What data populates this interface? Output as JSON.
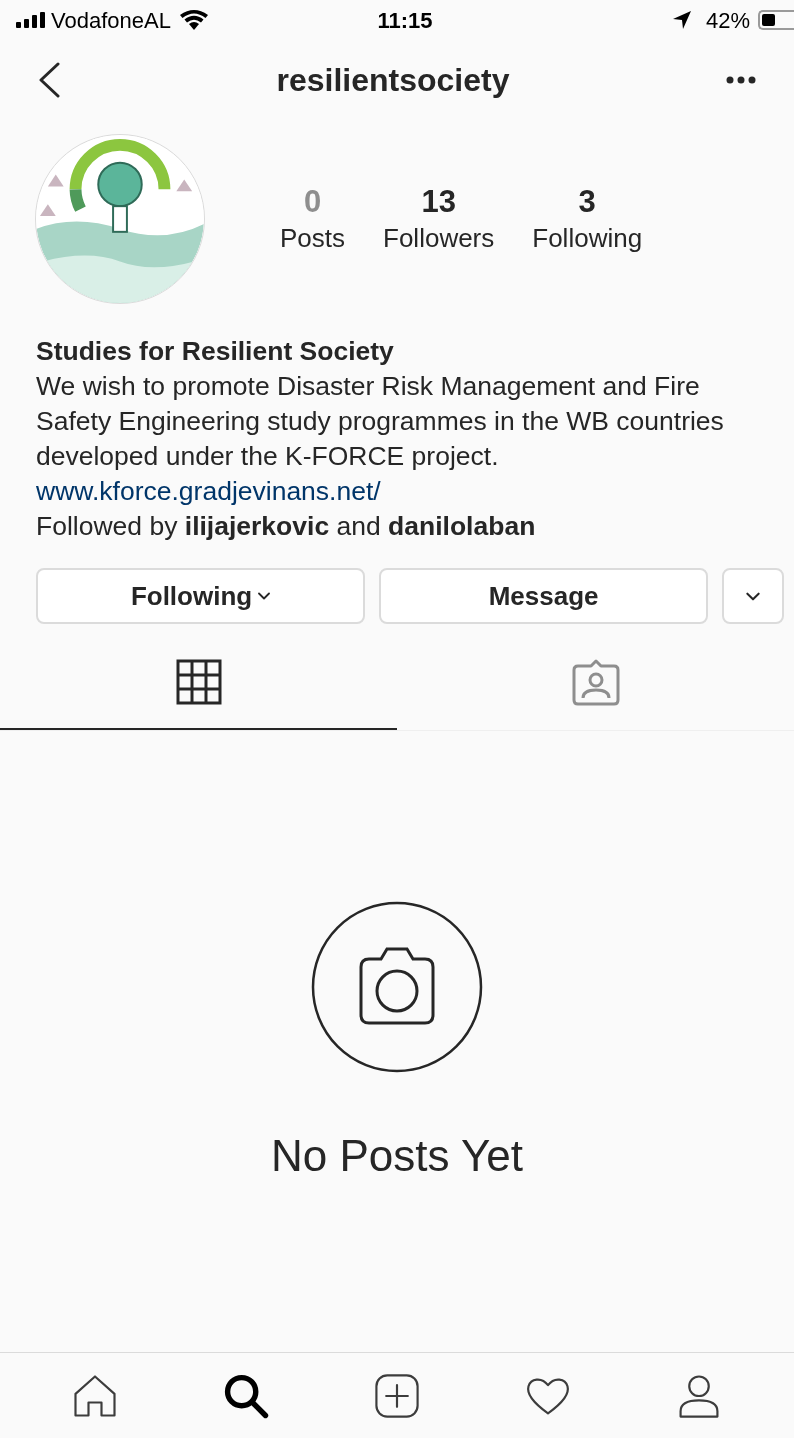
{
  "status_bar": {
    "carrier": "VodafoneAL",
    "time": "11:15",
    "battery": "42%"
  },
  "header": {
    "username": "resilientsociety"
  },
  "profile": {
    "stats": [
      {
        "count": "0",
        "label": "Posts",
        "zero": true
      },
      {
        "count": "13",
        "label": "Followers",
        "zero": false
      },
      {
        "count": "3",
        "label": "Following",
        "zero": false
      }
    ]
  },
  "bio": {
    "name": "Studies for Resilient Society",
    "description": "We wish to promote Disaster Risk Management and Fire Safety Engineering study programmes in the WB countries developed under the K-FORCE project.",
    "link": "www.kforce.gradjevinans.net/",
    "followed_by": "Followed by **ilijajerkovic** and **danilolaban**"
  },
  "actions": [
    {
      "label": "Following",
      "kind": "dropdown"
    },
    {
      "label": "Message",
      "kind": "plain"
    },
    {
      "kind": "more"
    }
  ],
  "tabs": [
    {
      "kind": "grid",
      "selected": true
    },
    {
      "kind": "tagged",
      "selected": false
    }
  ],
  "empty_state": {
    "message": "No Posts Yet"
  },
  "bottom_nav": [
    {
      "kind": "home",
      "selected": false
    },
    {
      "kind": "search",
      "selected": true
    },
    {
      "kind": "add",
      "selected": false
    },
    {
      "kind": "heart",
      "selected": false
    },
    {
      "kind": "profile",
      "selected": false
    }
  ]
}
